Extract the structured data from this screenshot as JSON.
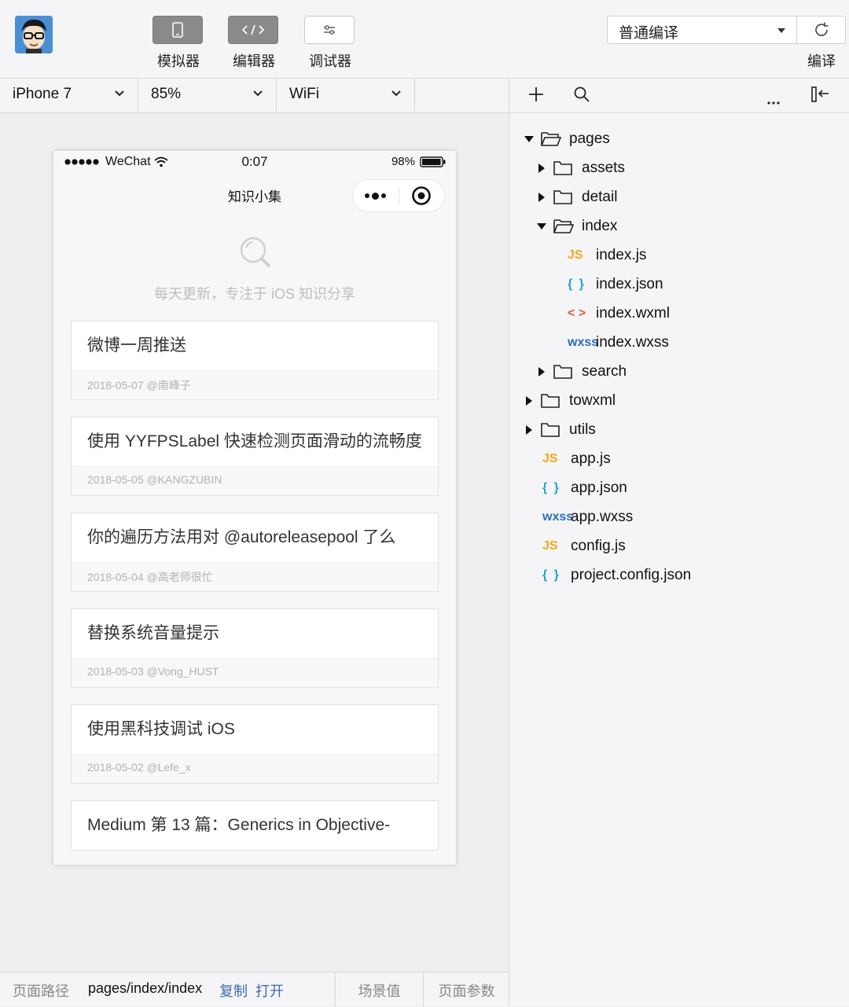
{
  "toolbar": {
    "simulator_label": "模拟器",
    "editor_label": "编辑器",
    "debugger_label": "调试器",
    "compile_mode": "普通编译",
    "compile_label": "编译"
  },
  "sim_options": {
    "device": "iPhone 7",
    "zoom": "85%",
    "network": "WiFi"
  },
  "phone": {
    "carrier": "WeChat",
    "time": "0:07",
    "battery": "98%",
    "battery_level": 0.98,
    "nav_title": "知识小集",
    "tagline": "每天更新，专注于 iOS 知识分享",
    "articles": [
      {
        "title": "微博一周推送",
        "meta": "2018-05-07 @南峰子"
      },
      {
        "title": "使用 YYFPSLabel 快速检测页面滑动的流畅度",
        "meta": "2018-05-05 @KANGZUBIN"
      },
      {
        "title": "你的遍历方法用对 @autoreleasepool 了么",
        "meta": "2018-05-04 @高老师很忙"
      },
      {
        "title": "替换系统音量提示",
        "meta": "2018-05-03 @Vong_HUST"
      },
      {
        "title": "使用黑科技调试 iOS",
        "meta": "2018-05-02 @Lefe_x"
      },
      {
        "title": "Medium 第 13 篇：Generics in Objective-",
        "meta": ""
      }
    ]
  },
  "pathbar": {
    "label": "页面路径",
    "path": "pages/index/index",
    "copy": "复制",
    "open": "打开",
    "scene": "场景值",
    "params": "页面参数"
  },
  "files": {
    "pages": "pages",
    "assets": "assets",
    "detail": "detail",
    "index": "index",
    "index_js": "index.js",
    "index_json": "index.json",
    "index_wxml": "index.wxml",
    "index_wxss": "index.wxss",
    "search": "search",
    "towxml": "towxml",
    "utils": "utils",
    "app_js": "app.js",
    "app_json": "app.json",
    "app_wxss": "app.wxss",
    "config_js": "config.js",
    "project_config_json": "project.config.json"
  },
  "icons": {
    "js": "JS",
    "json": "{ }",
    "wxml": "< >",
    "wxss": "wxss"
  }
}
